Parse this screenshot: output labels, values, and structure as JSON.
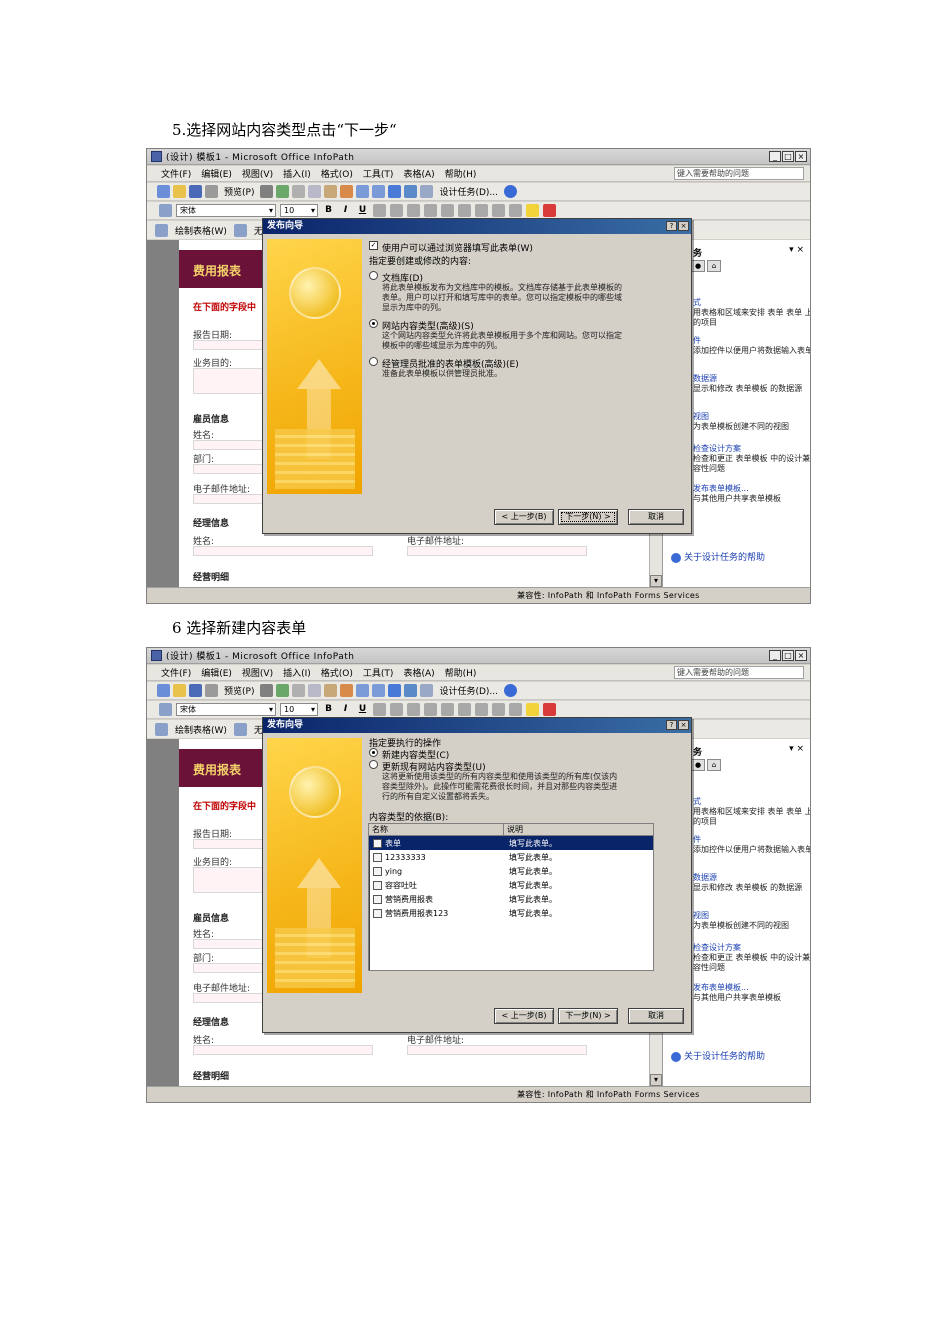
{
  "headings": {
    "step5": "5.选择网站内容类型点击“下一步“",
    "step6": "6 选择新建内容表单"
  },
  "window": {
    "title": "(设计) 模板1 - Microsoft Office InfoPath",
    "min": "_",
    "max": "□",
    "close": "×",
    "help_placeholder": "键入需要帮助的问题"
  },
  "menus": [
    "文件(F)",
    "编辑(E)",
    "视图(V)",
    "插入(I)",
    "格式(O)",
    "工具(T)",
    "表格(A)",
    "帮助(H)"
  ],
  "toolbar": {
    "preview": "预览(P)",
    "design_tasks": "设计任务(D)...",
    "font": "宋体",
    "size": "10",
    "bold": "B",
    "italic": "I",
    "underline": "U",
    "draw_table": "绘制表格(W)",
    "no_border": "无边"
  },
  "form": {
    "banner": "费用报表",
    "instruction": "在下面的字段中",
    "report_date": "报告日期:",
    "business_purpose": "业务目的:",
    "employee_info": "雇员信息",
    "name": "姓名:",
    "department": "部门:",
    "email": "电子邮件地址:",
    "manager_info": "经理信息",
    "manager_name": "姓名:",
    "manager_email": "电子邮件地址:",
    "expense_detail": "经营明细"
  },
  "taskpane": {
    "title": "务",
    "close": "▾ ×",
    "entries": [
      {
        "link": "式",
        "desc": "用表格和区域来安排 表单 表单 上的项目"
      },
      {
        "link": "件",
        "desc": "添加控件以便用户将数据输入表单"
      },
      {
        "link": "数据源",
        "desc": "显示和修改 表单模板 的数据源"
      },
      {
        "link": "视图",
        "desc": "为表单模板创建不同的视图"
      },
      {
        "link": "检查设计方案",
        "desc": "检查和更正 表单模板 中的设计兼容性问题"
      },
      {
        "link": "发布表单模板...",
        "desc": "与其他用户共享表单模板"
      }
    ],
    "help_link": "关于设计任务的帮助"
  },
  "status": {
    "compat": "兼容性: InfoPath 和 InfoPath Forms Services"
  },
  "dialog1": {
    "title": "发布向导",
    "help": "?",
    "close": "×",
    "browser_checkbox": "使用户可以通过浏览器填写此表单(W)",
    "prompt": "指定要创建或修改的内容:",
    "option_doclib": "文档库(D)",
    "option_doclib_desc": "将此表单模板发布为文档库中的模板。文档库存储基于此表单模板的表单。用户可以打开和填写库中的表单。您可以指定模板中的哪些域显示为库中的列。",
    "option_site_content": "网站内容类型(高级)(S)",
    "option_site_content_desc": "这个网站内容类型允许将此表单模板用于多个库和网站。您可以指定模板中的哪些域显示为库中的列。",
    "option_admin": "经管理员批准的表单模板(高级)(E)",
    "option_admin_desc": "准备此表单模板以供管理员批准。",
    "back": "< 上一步(B)",
    "next": "下一步(N) >",
    "cancel": "取消"
  },
  "dialog2": {
    "title": "发布向导",
    "help": "?",
    "close": "×",
    "prompt": "指定要执行的操作",
    "option_new": "新建内容类型(C)",
    "option_update": "更新现有网站内容类型(U)",
    "update_desc": "这将更新使用该类型的所有内容类型和使用该类型的所有库(仅该内容类型除外)。此操作可能需花费很长时间，并且对那些内容类型进行的所有自定义设置都将丢失。",
    "list_label": "内容类型的依据(B):",
    "col_name": "名称",
    "col_desc": "说明",
    "rows": [
      {
        "name": "表单",
        "desc": "填写此表单。"
      },
      {
        "name": "12333333",
        "desc": "填写此表单。"
      },
      {
        "name": "ying",
        "desc": "填写此表单。"
      },
      {
        "name": "容容吐吐",
        "desc": "填写此表单。"
      },
      {
        "name": "营销费用报表",
        "desc": "填写此表单。"
      },
      {
        "name": "营销费用报表123",
        "desc": "填写此表单。"
      }
    ],
    "back": "< 上一步(B)",
    "next": "下一步(N) >",
    "cancel": "取消"
  }
}
